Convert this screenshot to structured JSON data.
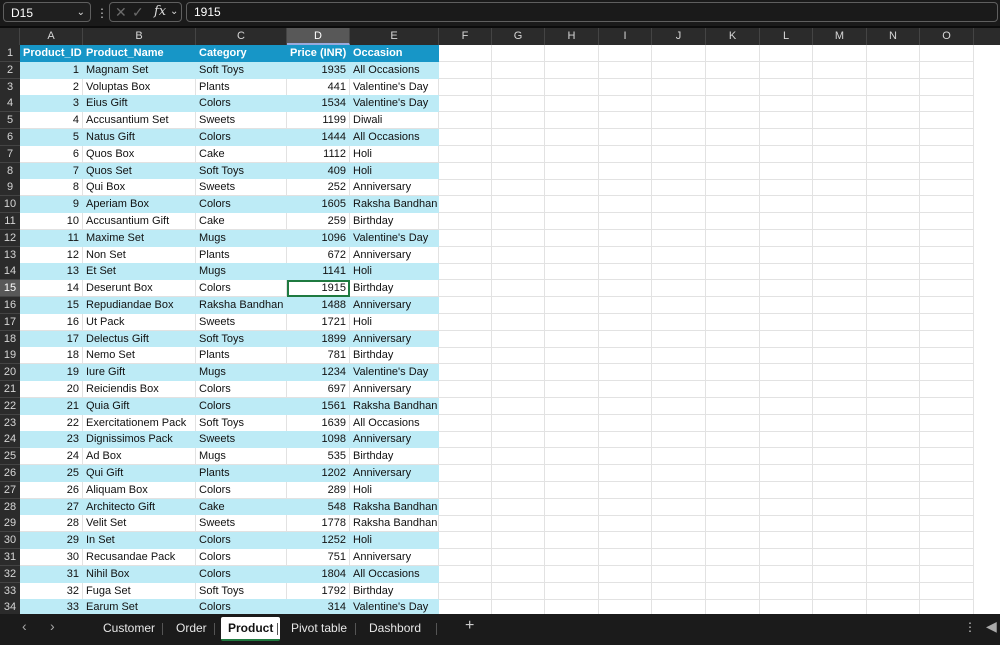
{
  "formula_bar": {
    "name_box": "D15",
    "formula": "1915"
  },
  "columns": [
    "A",
    "B",
    "C",
    "D",
    "E",
    "F",
    "G",
    "H",
    "I",
    "J",
    "K",
    "L",
    "M",
    "N",
    "O"
  ],
  "row_numbers": [
    "1",
    "2",
    "3",
    "4",
    "5",
    "6",
    "7",
    "8",
    "9",
    "10",
    "11",
    "12",
    "13",
    "14",
    "15",
    "16",
    "17",
    "18",
    "19",
    "20",
    "21",
    "22",
    "23",
    "24",
    "25",
    "26",
    "27",
    "28",
    "29",
    "30",
    "31",
    "32",
    "33",
    "34"
  ],
  "table": {
    "headers": [
      "Product_ID",
      "Product_Name",
      "Category",
      "Price (INR)",
      "Occasion"
    ],
    "rows": [
      [
        "1",
        "Magnam Set",
        "Soft Toys",
        "1935",
        "All Occasions"
      ],
      [
        "2",
        "Voluptas Box",
        "Plants",
        "441",
        "Valentine's Day"
      ],
      [
        "3",
        "Eius Gift",
        "Colors",
        "1534",
        "Valentine's Day"
      ],
      [
        "4",
        "Accusantium Set",
        "Sweets",
        "1199",
        "Diwali"
      ],
      [
        "5",
        "Natus Gift",
        "Colors",
        "1444",
        "All Occasions"
      ],
      [
        "6",
        "Quos Box",
        "Cake",
        "1112",
        "Holi"
      ],
      [
        "7",
        "Quos Set",
        "Soft Toys",
        "409",
        "Holi"
      ],
      [
        "8",
        "Qui Box",
        "Sweets",
        "252",
        "Anniversary"
      ],
      [
        "9",
        "Aperiam Box",
        "Colors",
        "1605",
        "Raksha Bandhan"
      ],
      [
        "10",
        "Accusantium Gift",
        "Cake",
        "259",
        "Birthday"
      ],
      [
        "11",
        "Maxime Set",
        "Mugs",
        "1096",
        "Valentine's Day"
      ],
      [
        "12",
        "Non Set",
        "Plants",
        "672",
        "Anniversary"
      ],
      [
        "13",
        "Et Set",
        "Mugs",
        "1141",
        "Holi"
      ],
      [
        "14",
        "Deserunt Box",
        "Colors",
        "1915",
        "Birthday"
      ],
      [
        "15",
        "Repudiandae Box",
        "Raksha Bandhan",
        "1488",
        "Anniversary"
      ],
      [
        "16",
        "Ut Pack",
        "Sweets",
        "1721",
        "Holi"
      ],
      [
        "17",
        "Delectus Gift",
        "Soft Toys",
        "1899",
        "Anniversary"
      ],
      [
        "18",
        "Nemo Set",
        "Plants",
        "781",
        "Birthday"
      ],
      [
        "19",
        "Iure Gift",
        "Mugs",
        "1234",
        "Valentine's Day"
      ],
      [
        "20",
        "Reiciendis Box",
        "Colors",
        "697",
        "Anniversary"
      ],
      [
        "21",
        "Quia Gift",
        "Colors",
        "1561",
        "Raksha Bandhan"
      ],
      [
        "22",
        "Exercitationem Pack",
        "Soft Toys",
        "1639",
        "All Occasions"
      ],
      [
        "23",
        "Dignissimos Pack",
        "Sweets",
        "1098",
        "Anniversary"
      ],
      [
        "24",
        "Ad Box",
        "Mugs",
        "535",
        "Birthday"
      ],
      [
        "25",
        "Qui Gift",
        "Plants",
        "1202",
        "Anniversary"
      ],
      [
        "26",
        "Aliquam Box",
        "Colors",
        "289",
        "Holi"
      ],
      [
        "27",
        "Architecto Gift",
        "Cake",
        "548",
        "Raksha Bandhan"
      ],
      [
        "28",
        "Velit Set",
        "Sweets",
        "1778",
        "Raksha Bandhan"
      ],
      [
        "29",
        "In Set",
        "Colors",
        "1252",
        "Holi"
      ],
      [
        "30",
        "Recusandae Pack",
        "Colors",
        "751",
        "Anniversary"
      ],
      [
        "31",
        "Nihil Box",
        "Colors",
        "1804",
        "All Occasions"
      ],
      [
        "32",
        "Fuga Set",
        "Soft Toys",
        "1792",
        "Birthday"
      ],
      [
        "33",
        "Earum Set",
        "Colors",
        "314",
        "Valentine's Day"
      ]
    ]
  },
  "active_cell": {
    "row_label": "15",
    "column_label": "D"
  },
  "sheet_tabs": [
    {
      "label": "Customer",
      "active": false
    },
    {
      "label": "Order",
      "active": false
    },
    {
      "label": "Product",
      "active": true
    },
    {
      "label": "Pivot table",
      "active": false
    },
    {
      "label": "Dashbord",
      "active": false
    }
  ],
  "colors": {
    "header_fill": "#1796c7",
    "band_fill": "#bdebf6",
    "selection": "#1f7a40"
  }
}
